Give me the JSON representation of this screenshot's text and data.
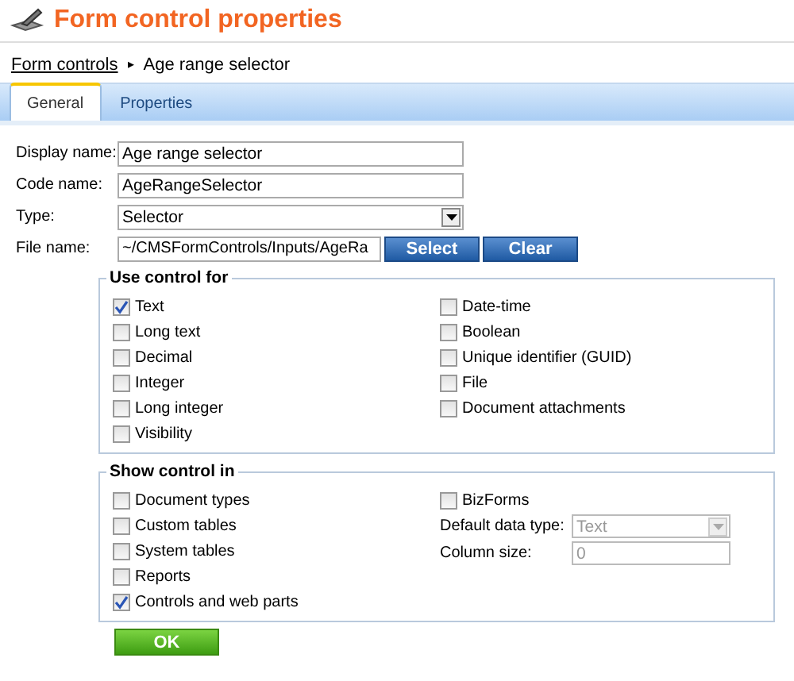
{
  "header": {
    "title": "Form control properties"
  },
  "breadcrumb": {
    "link": "Form controls",
    "separator": "▸",
    "current": "Age range selector"
  },
  "tabs": [
    {
      "label": "General",
      "selected": true
    },
    {
      "label": "Properties",
      "selected": false
    }
  ],
  "fields": [
    {
      "label": "Display name:",
      "kind": "text",
      "value": "Age range selector"
    },
    {
      "label": "Code name:",
      "kind": "text",
      "value": "AgeRangeSelector"
    },
    {
      "label": "Type:",
      "kind": "select",
      "value": "Selector"
    },
    {
      "label": "File name:",
      "kind": "file",
      "value": "~/CMSFormControls/Inputs/AgeRa",
      "buttons": [
        "Select",
        "Clear"
      ]
    }
  ],
  "use_control_for": {
    "legend": "Use control for",
    "columns": [
      [
        {
          "label": "Text",
          "checked": true
        },
        {
          "label": "Long text",
          "checked": false
        },
        {
          "label": "Decimal",
          "checked": false
        },
        {
          "label": "Integer",
          "checked": false
        },
        {
          "label": "Long integer",
          "checked": false
        },
        {
          "label": "Visibility",
          "checked": false
        }
      ],
      [
        {
          "label": "Date-time",
          "checked": false
        },
        {
          "label": "Boolean",
          "checked": false
        },
        {
          "label": "Unique identifier (GUID)",
          "checked": false
        },
        {
          "label": "File",
          "checked": false
        },
        {
          "label": "Document attachments",
          "checked": false
        }
      ]
    ]
  },
  "show_control_in": {
    "legend": "Show control in",
    "items": [
      {
        "label": "Document types",
        "checked": false
      },
      {
        "label": "Custom tables",
        "checked": false
      },
      {
        "label": "System tables",
        "checked": false
      },
      {
        "label": "Reports",
        "checked": false
      },
      {
        "label": "Controls and web parts",
        "checked": true
      }
    ],
    "bizforms": {
      "label": "BizForms",
      "checked": false
    },
    "default_data_type": {
      "label": "Default data type:",
      "value": "Text",
      "disabled": true
    },
    "column_size": {
      "label": "Column size:",
      "value": "0",
      "disabled": true
    }
  },
  "ok_button": "OK"
}
